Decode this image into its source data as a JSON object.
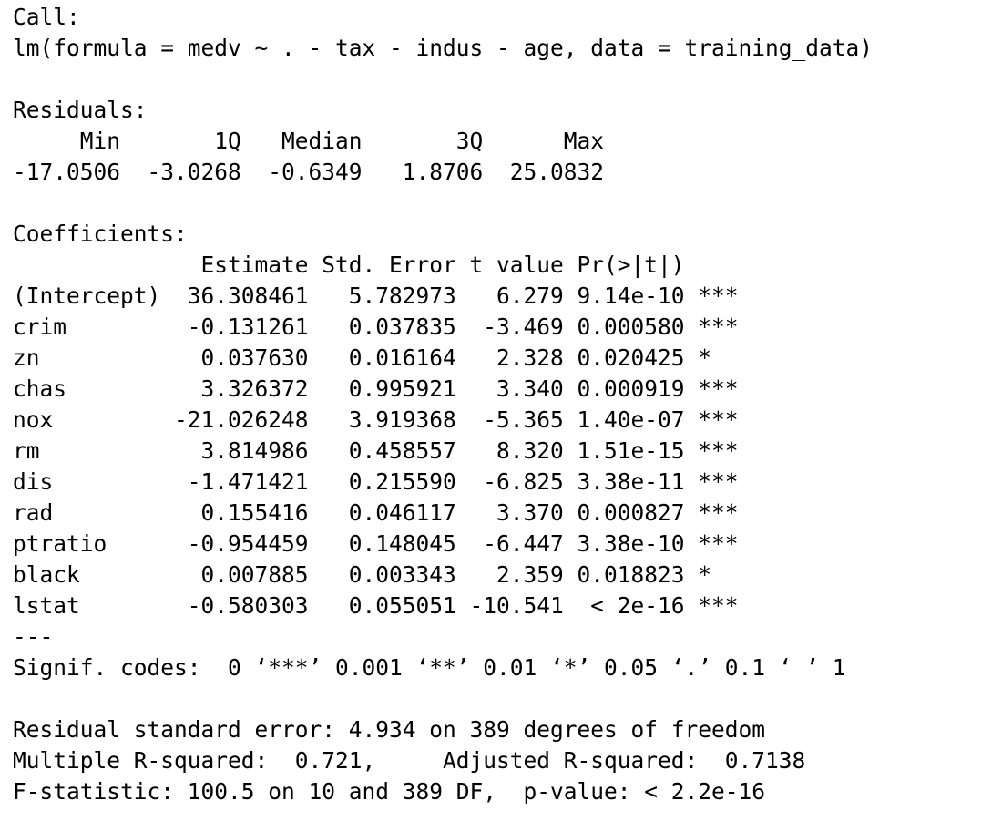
{
  "call": {
    "heading": "Call:",
    "formula": "lm(formula = medv ~ . - tax - indus - age, data = training_data)"
  },
  "residuals": {
    "heading": "Residuals:",
    "header_row": "     Min       1Q   Median       3Q      Max ",
    "values_row": "-17.0506  -3.0268  -0.6349   1.8706  25.0832 "
  },
  "coefficients": {
    "heading": "Coefficients:",
    "header_row": "              Estimate Std. Error t value Pr(>|t|)    ",
    "rows": [
      "(Intercept)  36.308461   5.782973   6.279 9.14e-10 ***",
      "crim         -0.131261   0.037835  -3.469 0.000580 ***",
      "zn            0.037630   0.016164   2.328 0.020425 *  ",
      "chas          3.326372   0.995921   3.340 0.000919 ***",
      "nox         -21.026248   3.919368  -5.365 1.40e-07 ***",
      "rm            3.814986   0.458557   8.320 1.51e-15 ***",
      "dis          -1.471421   0.215590  -6.825 3.38e-11 ***",
      "rad           0.155416   0.046117   3.370 0.000827 ***",
      "ptratio      -0.954459   0.148045  -6.447 3.38e-10 ***",
      "black         0.007885   0.003343   2.359 0.018823 *  ",
      "lstat        -0.580303   0.055051 -10.541  < 2e-16 ***"
    ],
    "separator": "---",
    "signif_codes": "Signif. codes:  0 ‘***’ 0.001 ‘**’ 0.01 ‘*’ 0.05 ‘.’ 0.1 ‘ ’ 1"
  },
  "summary_stats": {
    "residual_se": "Residual standard error: 4.934 on 389 degrees of freedom",
    "r_squared": "Multiple R-squared:  0.721,\tAdjusted R-squared:  0.7138 ",
    "f_statistic": "F-statistic: 100.5 on 10 and 389 DF,  p-value: < 2.2e-16"
  }
}
